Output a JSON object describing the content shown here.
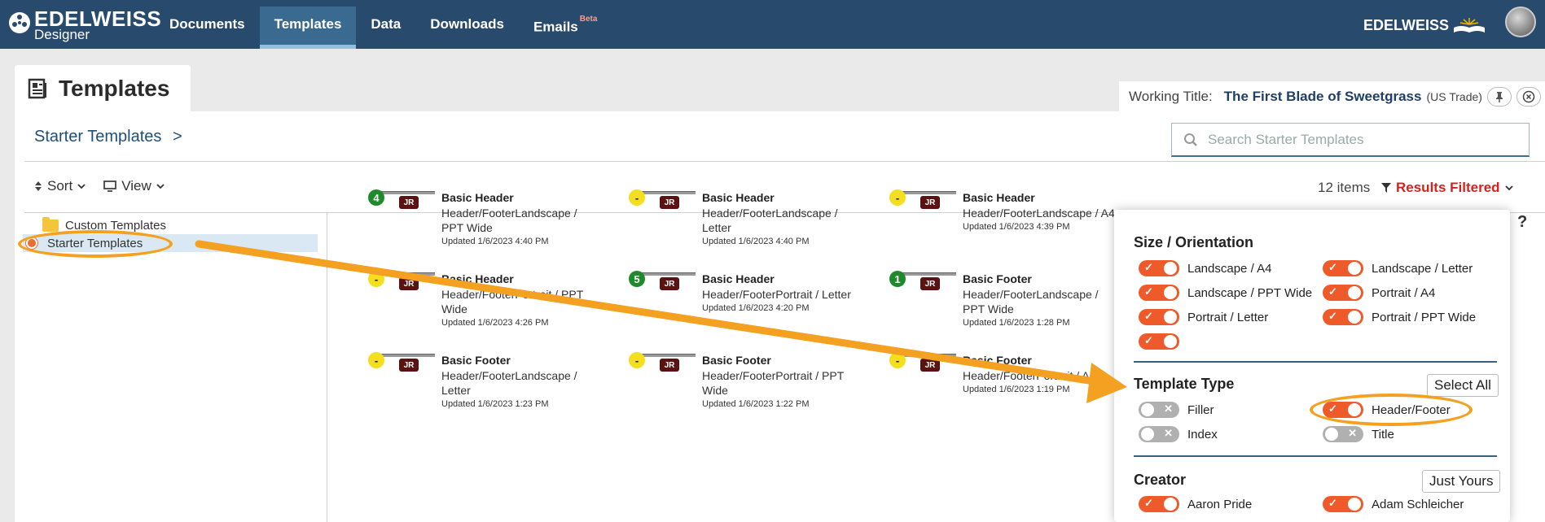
{
  "header": {
    "logo_title": "EDELWEISS",
    "logo_subtitle": "Designer",
    "nav": [
      {
        "label": "Documents"
      },
      {
        "label": "Templates"
      },
      {
        "label": "Data"
      },
      {
        "label": "Downloads"
      },
      {
        "label": "Emails"
      }
    ],
    "emails_badge": "Beta",
    "brand_right": "EDELWEISS"
  },
  "panel": {
    "title": "Templates"
  },
  "working_title": {
    "label": "Working Title:",
    "value": "The First Blade of Sweetgrass",
    "edition": "(US Trade)"
  },
  "breadcrumb": {
    "text": "Starter Templates",
    "sep": ">"
  },
  "search": {
    "placeholder": "Search Starter Templates"
  },
  "toolbar": {
    "sort": "Sort",
    "view": "View"
  },
  "results": {
    "count": "12 items",
    "filtered": "Results Filtered"
  },
  "tree": [
    {
      "label": "Custom Templates"
    },
    {
      "label": "Starter Templates"
    }
  ],
  "cards": [
    {
      "badge": "4",
      "badge_color": "green",
      "creator": "JR",
      "title": "Basic Header",
      "subtitle": "Header/FooterLandscape / PPT Wide",
      "updated": "Updated 1/6/2023 4:40 PM"
    },
    {
      "badge": "-",
      "badge_color": "yellow",
      "creator": "JR",
      "title": "Basic Header",
      "subtitle": "Header/FooterLandscape / Letter",
      "updated": "Updated 1/6/2023 4:40 PM"
    },
    {
      "badge": "-",
      "badge_color": "yellow",
      "creator": "JR",
      "title": "Basic Header",
      "subtitle": "Header/FooterLandscape / A4",
      "updated": "Updated 1/6/2023 4:39 PM"
    },
    {
      "badge": "-",
      "badge_color": "yellow",
      "creator": "JR",
      "title": "Basic Header",
      "subtitle": "Header/FooterPortrait / PPT Wide",
      "updated": "Updated 1/6/2023 4:26 PM"
    },
    {
      "badge": "5",
      "badge_color": "green",
      "creator": "JR",
      "title": "Basic Header",
      "subtitle": "Header/FooterPortrait / Letter",
      "updated": "Updated 1/6/2023 4:20 PM"
    },
    {
      "badge": "1",
      "badge_color": "green",
      "creator": "JR",
      "title": "Basic Footer",
      "subtitle": "Header/FooterLandscape / PPT Wide",
      "updated": "Updated 1/6/2023 1:28 PM"
    },
    {
      "badge": "-",
      "badge_color": "yellow",
      "creator": "JR",
      "title": "Basic Footer",
      "subtitle": "Header/FooterLandscape / Letter",
      "updated": "Updated 1/6/2023 1:23 PM"
    },
    {
      "badge": "-",
      "badge_color": "yellow",
      "creator": "JR",
      "title": "Basic Footer",
      "subtitle": "Header/FooterPortrait / PPT Wide",
      "updated": "Updated 1/6/2023 1:22 PM"
    },
    {
      "badge": "-",
      "badge_color": "yellow",
      "creator": "JR",
      "title": "Basic Footer",
      "subtitle": "Header/FooterPortrait / A4",
      "updated": "Updated 1/6/2023 1:19 PM"
    }
  ],
  "filter": {
    "size_title": "Size / Orientation",
    "sizes": [
      {
        "label": "Landscape / A4",
        "on": true
      },
      {
        "label": "Landscape / Letter",
        "on": true
      },
      {
        "label": "Landscape / PPT Wide",
        "on": true
      },
      {
        "label": "Portrait / A4",
        "on": true
      },
      {
        "label": "Portrait / Letter",
        "on": true
      },
      {
        "label": "Portrait / PPT Wide",
        "on": true
      },
      {
        "label": "",
        "on": true
      }
    ],
    "type_title": "Template Type",
    "select_all": "Select All",
    "types": [
      {
        "label": "Filler",
        "on": false
      },
      {
        "label": "Header/Footer",
        "on": true
      },
      {
        "label": "Index",
        "on": false
      },
      {
        "label": "Title",
        "on": false
      }
    ],
    "creator_title": "Creator",
    "just_yours": "Just Yours",
    "creators": [
      {
        "label": "Aaron Pride",
        "on": true
      },
      {
        "label": "Adam Schleicher",
        "on": true
      }
    ]
  },
  "colors": {
    "header_bg": "#284a6c",
    "accent": "#ee5a2a",
    "annotation": "#f4a020",
    "filtered": "#d6221f"
  }
}
